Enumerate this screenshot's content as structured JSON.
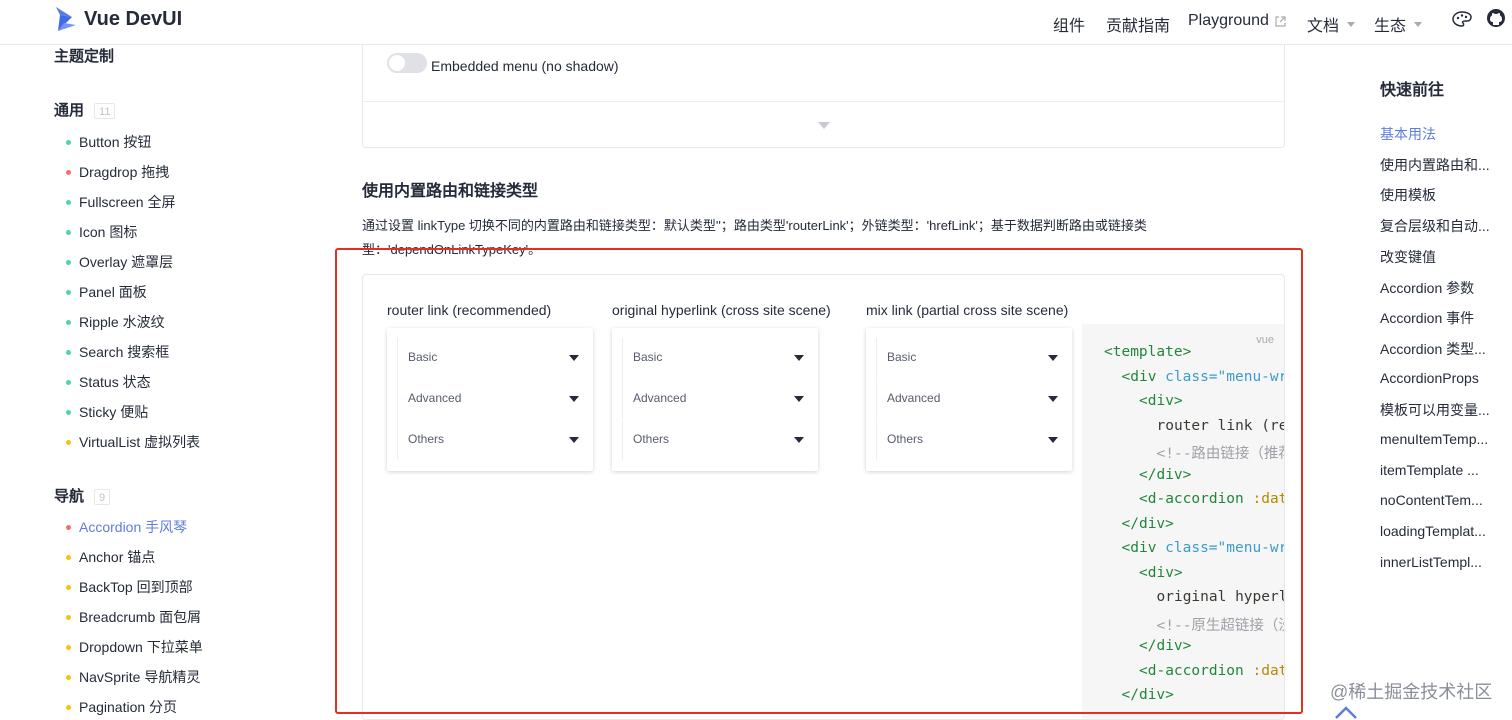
{
  "header": {
    "title": "Vue DevUI",
    "nav": [
      {
        "label": "组件"
      },
      {
        "label": "贡献指南"
      },
      {
        "label": "Playground"
      },
      {
        "label": "文档"
      },
      {
        "label": "生态"
      }
    ]
  },
  "sidebar": {
    "theme_title": "主题定制",
    "groups": [
      {
        "title": "通用",
        "count": "11",
        "items": [
          {
            "label": "Button 按钮",
            "color": "#50d4ab"
          },
          {
            "label": "Dragdrop 拖拽",
            "color": "#f66f6a"
          },
          {
            "label": "Fullscreen 全屏",
            "color": "#50d4ab"
          },
          {
            "label": "Icon 图标",
            "color": "#50d4ab"
          },
          {
            "label": "Overlay 遮罩层",
            "color": "#50d4ab"
          },
          {
            "label": "Panel 面板",
            "color": "#50d4ab"
          },
          {
            "label": "Ripple 水波纹",
            "color": "#50d4ab"
          },
          {
            "label": "Search 搜索框",
            "color": "#50d4ab"
          },
          {
            "label": "Status 状态",
            "color": "#50d4ab"
          },
          {
            "label": "Sticky 便贴",
            "color": "#50d4ab"
          },
          {
            "label": "VirtualList 虚拟列表",
            "color": "#fac20a"
          }
        ]
      },
      {
        "title": "导航",
        "count": "9",
        "items": [
          {
            "label": "Accordion 手风琴",
            "color": "#f66f6a",
            "active": true
          },
          {
            "label": "Anchor 锚点",
            "color": "#fac20a"
          },
          {
            "label": "BackTop 回到顶部",
            "color": "#fac20a"
          },
          {
            "label": "Breadcrumb 面包屑",
            "color": "#fac20a"
          },
          {
            "label": "Dropdown 下拉菜单",
            "color": "#fac20a"
          },
          {
            "label": "NavSprite 导航精灵",
            "color": "#fac20a"
          },
          {
            "label": "Pagination 分页",
            "color": "#fac20a"
          }
        ]
      }
    ]
  },
  "main": {
    "toggle_label": "Embedded menu (no shadow)",
    "section_title": "使用内置路由和链接类型",
    "section_desc": "通过设置 linkType 切换不同的内置路由和链接类型：默认类型''；路由类型'routerLink'；外链类型：'hrefLink'；基于数据判断路由或链接类型：'dependOnLinkTypeKey'。",
    "columns": [
      {
        "title": "router link (recommended)",
        "items": [
          "Basic",
          "Advanced",
          "Others"
        ]
      },
      {
        "title": "original hyperlink (cross site scene)",
        "items": [
          "Basic",
          "Advanced",
          "Others"
        ]
      },
      {
        "title": "mix link (partial cross site scene)",
        "items": [
          "Basic",
          "Advanced",
          "Others"
        ]
      }
    ],
    "code": {
      "lang": "vue",
      "lines": [
        {
          "indent": 0,
          "tag": "<template>",
          "rest": "",
          "kind": "tag"
        },
        {
          "indent": 1,
          "tag": "<div",
          "attr": " class=",
          "val": "\"menu-wr",
          "kind": "tag-attr"
        },
        {
          "indent": 2,
          "tag": "<div>",
          "rest": "",
          "kind": "tag"
        },
        {
          "indent": 3,
          "text": "router link (re",
          "kind": "text"
        },
        {
          "indent": 3,
          "text": "<!--路由链接（推荐",
          "kind": "comment"
        },
        {
          "indent": 2,
          "tag": "</div>",
          "rest": "",
          "kind": "tag"
        },
        {
          "indent": 2,
          "tag": "<d-accordion",
          "attr": " :dat",
          "val": "",
          "kind": "tag-attr2"
        },
        {
          "indent": 1,
          "tag": "</div>",
          "rest": "",
          "kind": "tag"
        },
        {
          "indent": 1,
          "tag": "<div",
          "attr": " class=",
          "val": "\"menu-wr",
          "kind": "tag-attr"
        },
        {
          "indent": 2,
          "tag": "<div>",
          "rest": "",
          "kind": "tag"
        },
        {
          "indent": 3,
          "text": "original hyperl",
          "kind": "text"
        },
        {
          "indent": 3,
          "text": "<!--原生超链接（没",
          "kind": "comment"
        },
        {
          "indent": 2,
          "tag": "</div>",
          "rest": "",
          "kind": "tag"
        },
        {
          "indent": 2,
          "tag": "<d-accordion",
          "attr": " :dat",
          "val": "",
          "kind": "tag-attr2"
        },
        {
          "indent": 1,
          "tag": "</div>",
          "rest": "",
          "kind": "tag"
        }
      ]
    }
  },
  "toc": {
    "title": "快速前往",
    "items": [
      {
        "label": "基本用法",
        "active": true
      },
      {
        "label": "使用内置路由和..."
      },
      {
        "label": "使用模板"
      },
      {
        "label": "复合层级和自动..."
      },
      {
        "label": "改变键值"
      },
      {
        "label": "Accordion 参数"
      },
      {
        "label": "Accordion 事件"
      },
      {
        "label": "Accordion 类型..."
      },
      {
        "label": "AccordionProps"
      },
      {
        "label": "模板可以用变量..."
      },
      {
        "label": "menuItemTemp..."
      },
      {
        "label": "itemTemplate ..."
      },
      {
        "label": "noContentTem..."
      },
      {
        "label": "loadingTemplat..."
      },
      {
        "label": "innerListTempl..."
      }
    ]
  },
  "watermark": "@稀土掘金技术社区"
}
